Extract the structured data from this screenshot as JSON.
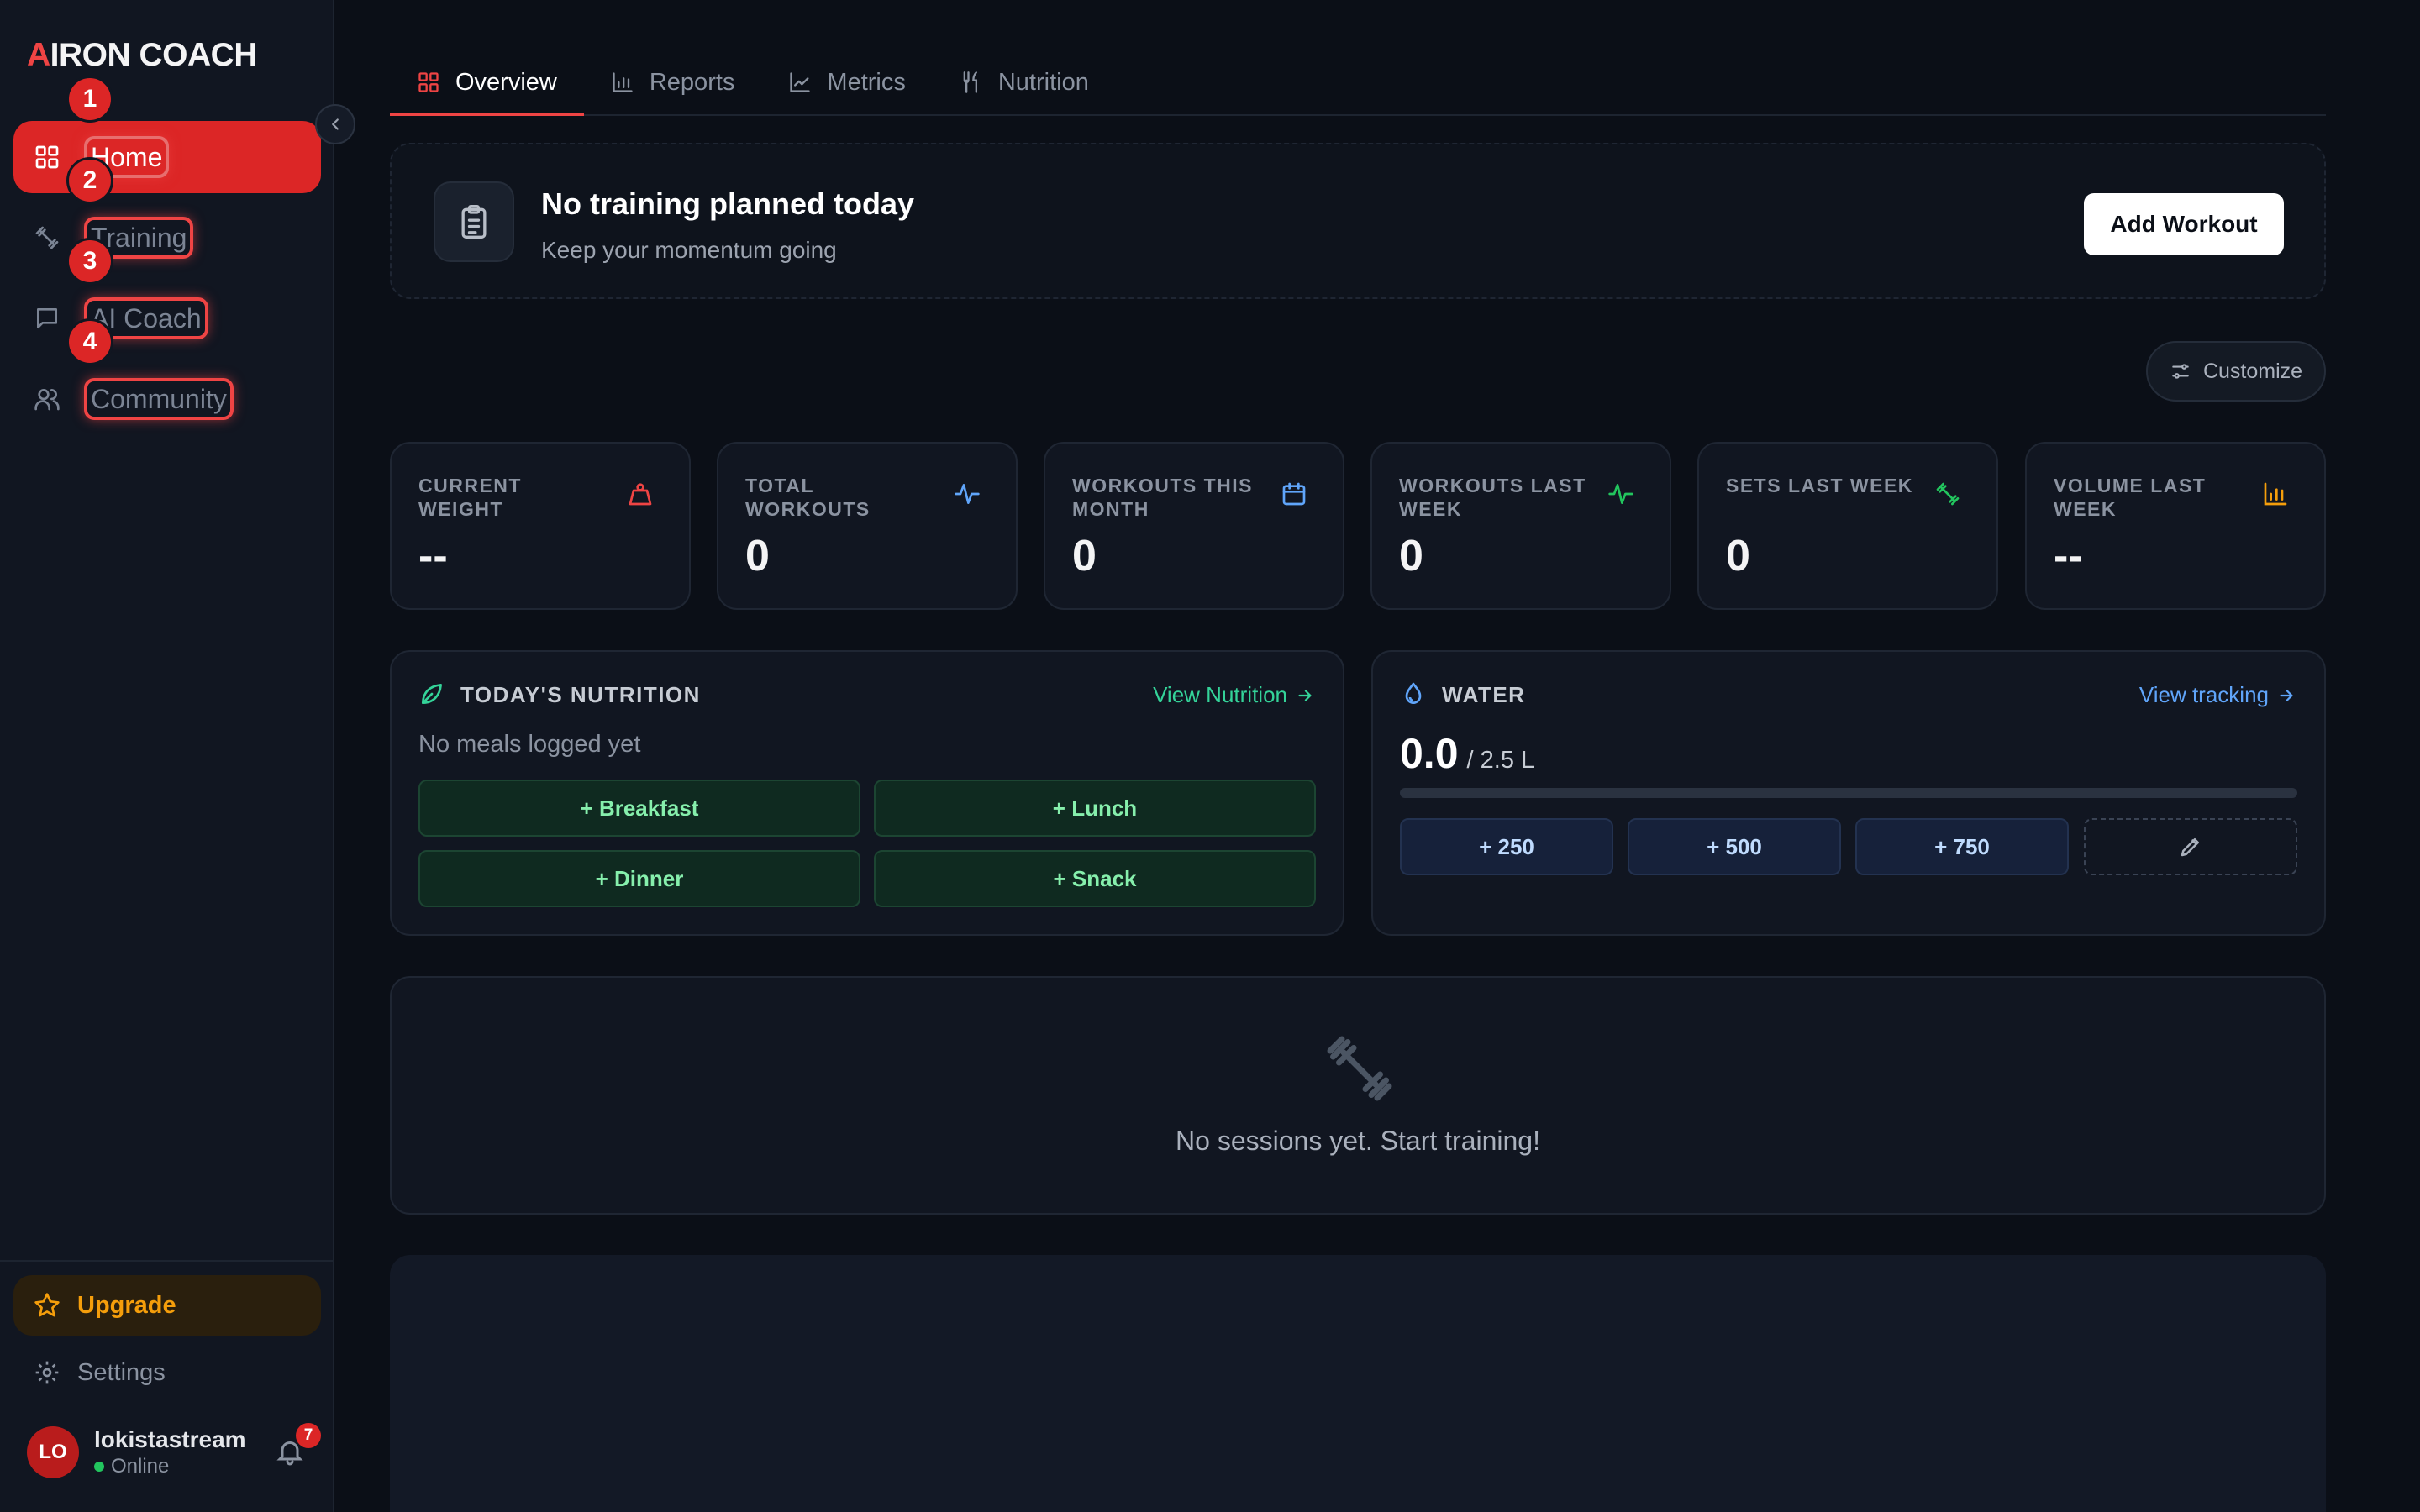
{
  "brand": {
    "prefix": "A",
    "name": "IRON COACH",
    "accent": "#ef4444"
  },
  "sidebar": {
    "collapse_icon": "chevron-left-icon",
    "items": [
      {
        "label": "Home",
        "icon": "grid-icon",
        "marker": "1",
        "active": true
      },
      {
        "label": "Training",
        "icon": "dumbbell-icon",
        "marker": "2",
        "active": false
      },
      {
        "label": "AI Coach",
        "icon": "chat-icon",
        "marker": "3",
        "active": false
      },
      {
        "label": "Community",
        "icon": "users-icon",
        "marker": "4",
        "active": false
      }
    ],
    "upgrade_label": "Upgrade",
    "settings_label": "Settings",
    "user": {
      "initials": "LO",
      "name": "lokistastream",
      "status": "Online",
      "notifications": "7"
    }
  },
  "tabs": [
    {
      "label": "Overview",
      "icon": "grid-icon",
      "active": true
    },
    {
      "label": "Reports",
      "icon": "bar-chart-icon",
      "active": false
    },
    {
      "label": "Metrics",
      "icon": "line-chart-icon",
      "active": false
    },
    {
      "label": "Nutrition",
      "icon": "utensils-icon",
      "active": false
    }
  ],
  "plan": {
    "title": "No training planned today",
    "subtitle": "Keep your momentum going",
    "button": "Add Workout"
  },
  "customize_label": "Customize",
  "stats": [
    {
      "label": "CURRENT WEIGHT",
      "value": "--",
      "icon": "weight-icon",
      "color": "#ef4444"
    },
    {
      "label": "TOTAL WORKOUTS",
      "value": "0",
      "icon": "activity-icon",
      "color": "#60a5fa"
    },
    {
      "label": "WORKOUTS THIS MONTH",
      "value": "0",
      "icon": "calendar-icon",
      "color": "#60a5fa"
    },
    {
      "label": "WORKOUTS LAST WEEK",
      "value": "0",
      "icon": "activity-icon",
      "color": "#22c55e"
    },
    {
      "label": "SETS LAST WEEK",
      "value": "0",
      "icon": "dumbbell-icon",
      "color": "#22c55e"
    },
    {
      "label": "VOLUME LAST WEEK",
      "value": "--",
      "icon": "bar-chart-icon",
      "color": "#f59e0b"
    }
  ],
  "nutrition": {
    "title": "TODAY'S NUTRITION",
    "link": "View Nutrition",
    "empty": "No meals logged yet",
    "meals": [
      "+ Breakfast",
      "+ Lunch",
      "+ Dinner",
      "+ Snack"
    ],
    "accent": "#34d399"
  },
  "water": {
    "title": "WATER",
    "link": "View tracking",
    "value": "0.0",
    "goal": "/ 2.5 L",
    "progress": 0,
    "buttons": [
      "+ 250",
      "+ 500",
      "+ 750"
    ],
    "edit_icon": "pencil-icon",
    "accent": "#60a5fa"
  },
  "sessions": {
    "empty": "No sessions yet. Start training!",
    "icon": "dumbbell-icon"
  }
}
